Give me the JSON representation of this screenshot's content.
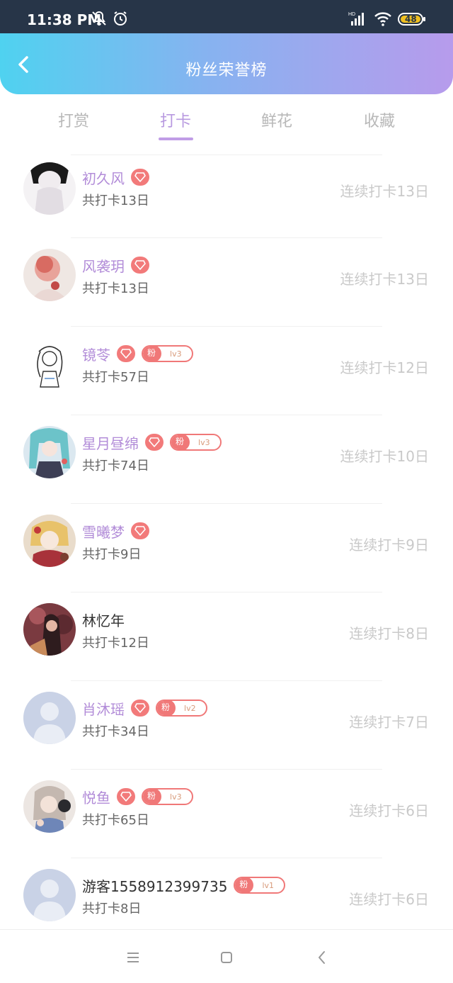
{
  "status_bar": {
    "time": "11:38 PM",
    "icons": [
      "bell-off-icon",
      "alarm-icon",
      "hd-signal-icon",
      "wifi-icon",
      "battery-icon"
    ],
    "battery_level": "48"
  },
  "header": {
    "back_icon": "chevron-left-icon",
    "title": "粉丝荣誉榜"
  },
  "tabs": [
    {
      "label": "打赏",
      "active": false
    },
    {
      "label": "打卡",
      "active": true
    },
    {
      "label": "鲜花",
      "active": false
    },
    {
      "label": "收藏",
      "active": false
    }
  ],
  "list": [
    {
      "name": "初久风",
      "vip": true,
      "fan_badge": null,
      "total": "共打卡13日",
      "streak": "连续打卡13日",
      "avatar": "sketch-girl"
    },
    {
      "name": "风袭玥",
      "vip": true,
      "fan_badge": null,
      "total": "共打卡13日",
      "streak": "连续打卡13日",
      "avatar": "portrait-red"
    },
    {
      "name": "镜苓",
      "vip": true,
      "fan_badge": {
        "tag": "粉",
        "level": "lv3"
      },
      "total": "共打卡57日",
      "streak": "连续打卡12日",
      "avatar": "line-drawing"
    },
    {
      "name": "星月昼绵",
      "vip": true,
      "fan_badge": {
        "tag": "粉",
        "level": "lv3"
      },
      "total": "共打卡74日",
      "streak": "连续打卡10日",
      "avatar": "anime-teal"
    },
    {
      "name": "雪曦梦",
      "vip": true,
      "fan_badge": null,
      "total": "共打卡9日",
      "streak": "连续打卡9日",
      "avatar": "anime-blonde"
    },
    {
      "name": "林忆年",
      "vip": false,
      "fan_badge": null,
      "total": "共打卡12日",
      "streak": "连续打卡8日",
      "avatar": "photo-dark"
    },
    {
      "name": "肖沐瑶",
      "vip": true,
      "fan_badge": {
        "tag": "粉",
        "level": "lv2"
      },
      "total": "共打卡34日",
      "streak": "连续打卡7日",
      "avatar": "default"
    },
    {
      "name": "悦鱼",
      "vip": true,
      "fan_badge": {
        "tag": "粉",
        "level": "lv3"
      },
      "total": "共打卡65日",
      "streak": "连续打卡6日",
      "avatar": "headphone-girl"
    },
    {
      "name": "游客1558912399735",
      "vip": false,
      "fan_badge": {
        "tag": "粉",
        "level": "lv1"
      },
      "total": "共打卡8日",
      "streak": "连续打卡6日",
      "avatar": "default"
    }
  ],
  "nav_bar": {
    "icons": [
      "menu-icon",
      "home-square-icon",
      "back-triangle-icon"
    ]
  },
  "colors": {
    "gradient_start": "#4fd2f0",
    "gradient_end": "#b79bec",
    "accent_purple": "#b28cd8",
    "badge_red": "#f07878"
  }
}
